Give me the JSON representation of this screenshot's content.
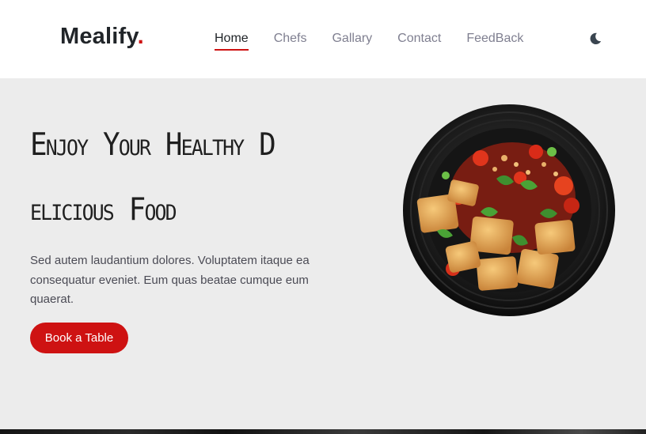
{
  "brand": {
    "name": "Mealify",
    "dot": ".",
    "accent_color": "#ce1212"
  },
  "nav": {
    "items": [
      {
        "label": "Home",
        "active": true
      },
      {
        "label": "Chefs",
        "active": false
      },
      {
        "label": "Gallary",
        "active": false
      },
      {
        "label": "Contact",
        "active": false
      },
      {
        "label": "FeedBack",
        "active": false
      }
    ],
    "theme_toggle_icon": "moon-icon"
  },
  "hero": {
    "title_line1": "Enjoy Your Healthy D",
    "title_line2": "elicious Food",
    "description": "Sed autem laudantium dolores. Voluptatem itaque ea consequatur eveniet. Eum quas beatae cumque eum quaerat.",
    "cta_label": "Book a Table",
    "image_icon": "food-dish-image"
  }
}
